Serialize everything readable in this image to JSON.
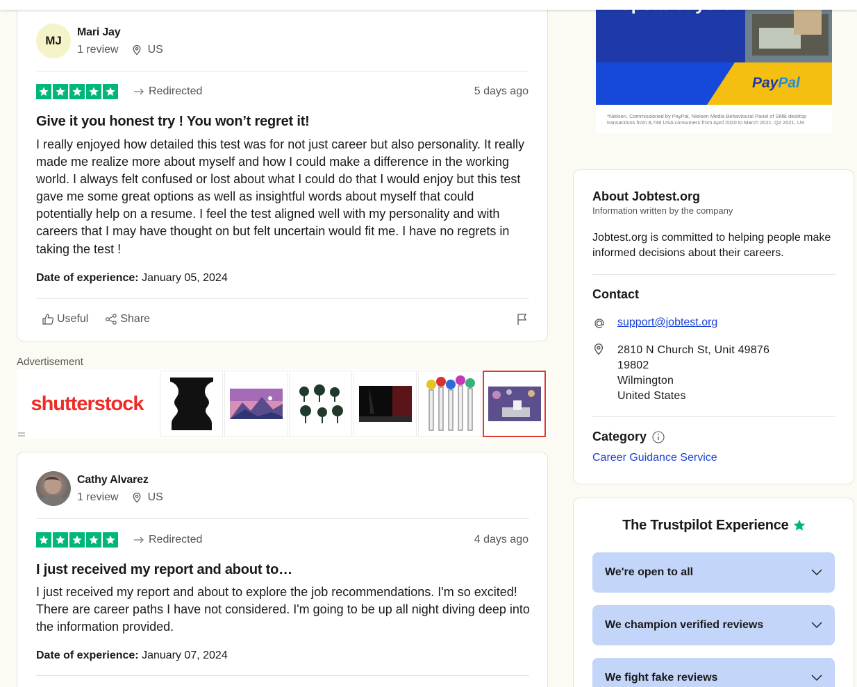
{
  "reviews": [
    {
      "initials": "MJ",
      "name": "Mari Jay",
      "review_count": "1 review",
      "country": "US",
      "status": "Redirected",
      "date_ago": "5 days ago",
      "title": "Give it you honest try ! You won’t regret it!",
      "body": "I really enjoyed how detailed this test was for not just career but also personality. It really made me realize more about myself and how I could make a difference in the working world. I always felt confused or lost about what I could do that I would enjoy but this test gave me some great options as well as insightful words about myself that could potentially help on a resume. I feel the test aligned well with my personality and with careers that I may have thought on but felt uncertain would fit me. I have no regrets in taking the test !",
      "exp_label": "Date of experience:",
      "exp_date": "January 05, 2024",
      "useful": "Useful",
      "share": "Share",
      "rating": 5
    },
    {
      "name": "Cathy Alvarez",
      "review_count": "1 review",
      "country": "US",
      "status": "Redirected",
      "date_ago": "4 days ago",
      "title": "I just received my report and about to…",
      "body": "I just received my report and about to explore the job recommendations. I'm so excited! There are career paths I have not considered. I'm going to be up all night diving deep into the information provided.",
      "exp_label": "Date of experience:",
      "exp_date": "January 07, 2024",
      "rating": 5
    }
  ],
  "ad": {
    "label": "Advertisement",
    "logo": "shutterstock"
  },
  "paypal_ad": {
    "headline": "repeat buyers.\"",
    "brand_a": "Pay",
    "brand_b": "Pal",
    "fine_print": "*Nielsen, Commissioned by PayPal, Nielsen Media Behavioural Panel of SMB desktop transactions from 8,746 USA consumers from April 2020 to March 2021. Q2 2021, US"
  },
  "about": {
    "title": "About Jobtest.org",
    "subtitle": "Information written by the company",
    "description": "Jobtest.org is committed to helping people make informed decisions about their careers.",
    "contact_head": "Contact",
    "email": "support@jobtest.org",
    "address": [
      "2810 N Church St, Unit 49876",
      "19802",
      "Wilmington",
      "United States"
    ],
    "category_head": "Category",
    "category": "Career Guidance Service"
  },
  "trustpilot": {
    "title": "The Trustpilot Experience",
    "items": [
      "We're open to all",
      "We champion verified reviews",
      "We fight fake reviews"
    ]
  },
  "colors": {
    "star_green": "#00b67a",
    "link_blue": "#1c42d4",
    "accordion_bg": "#c3d5f8",
    "page_bg": "#fcfbf3"
  }
}
